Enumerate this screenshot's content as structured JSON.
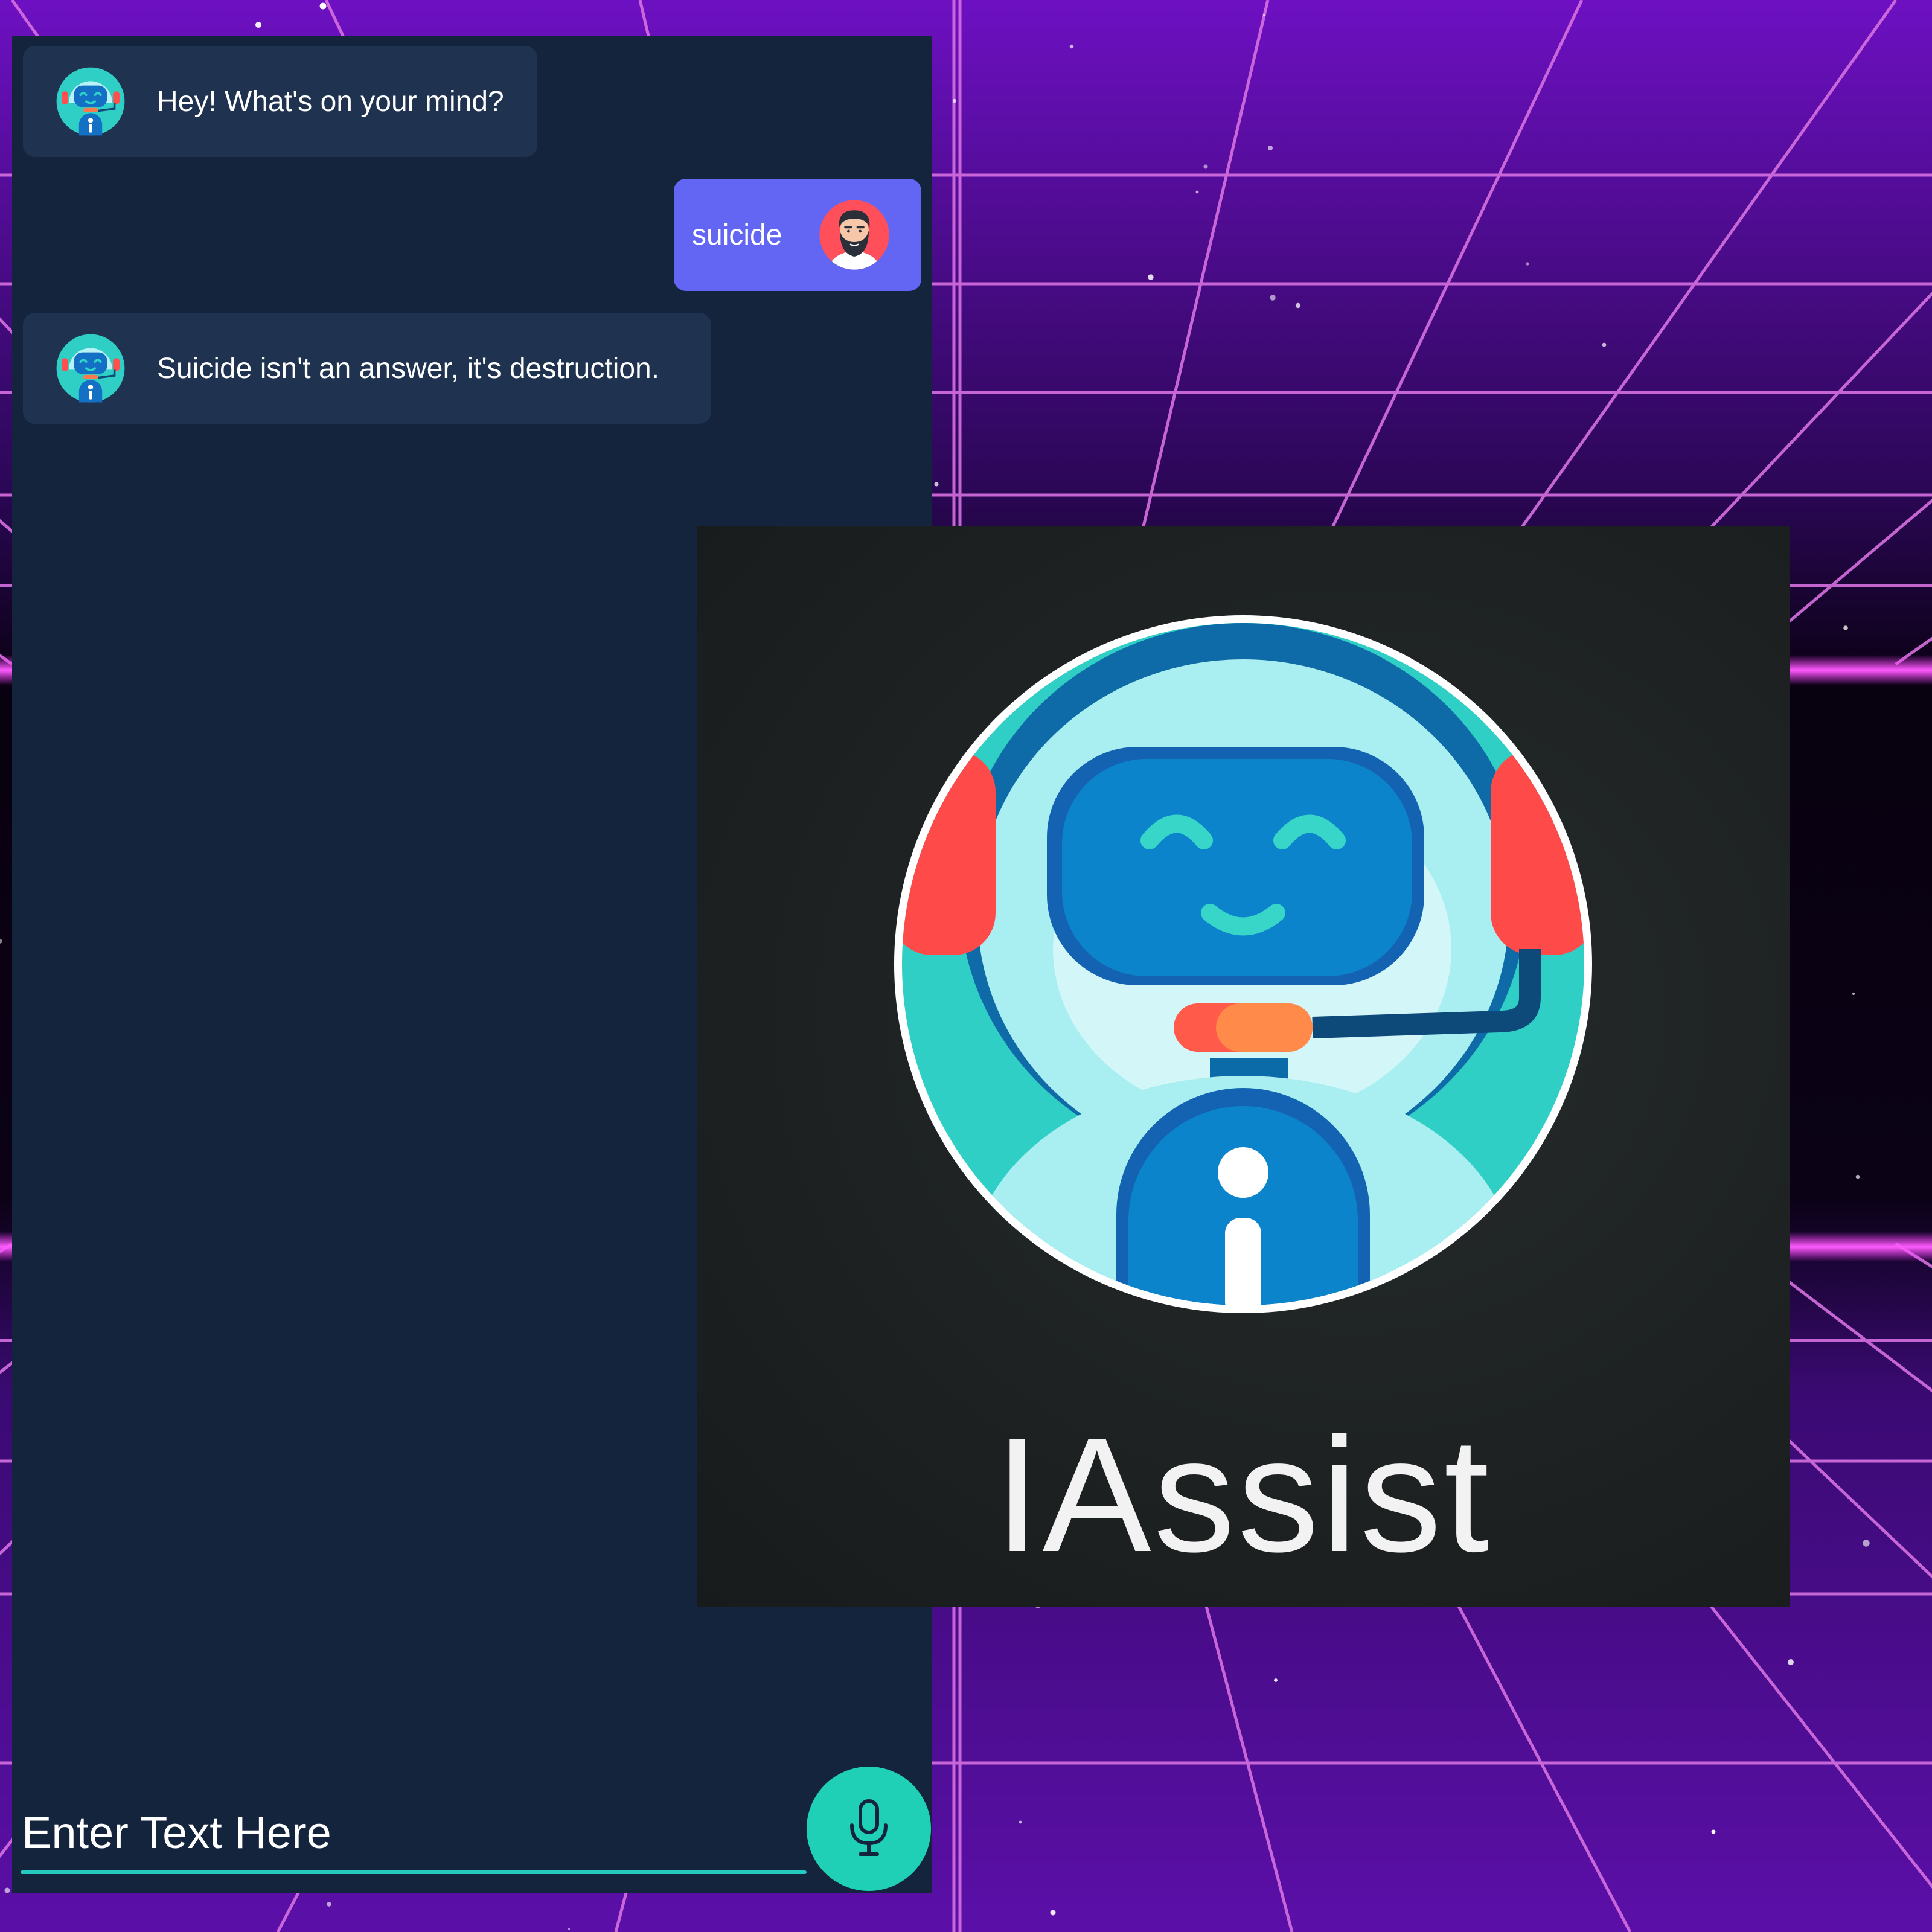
{
  "chat": {
    "messages": [
      {
        "sender": "bot",
        "text": "Hey! What's on your mind?",
        "avatar": "robot-avatar-icon"
      },
      {
        "sender": "user",
        "text": "suicide",
        "avatar": "bearded-man-avatar-icon"
      },
      {
        "sender": "bot",
        "text": "Suicide isn't an answer, it's destruction.",
        "avatar": "robot-avatar-icon"
      }
    ],
    "input": {
      "placeholder": "Enter Text Here",
      "value": ""
    },
    "mic_button": {
      "icon": "microphone-icon"
    }
  },
  "app_card": {
    "logo_icon": "robot-headset-logo-icon",
    "name": "IAssist"
  },
  "colors": {
    "chat_background": "#14243d",
    "bot_bubble": "#1f3351",
    "user_bubble": "#6366f2",
    "accent_teal": "#1fd0b6",
    "background_purple": "#3a0a78",
    "grid_line": "#d670e0"
  }
}
